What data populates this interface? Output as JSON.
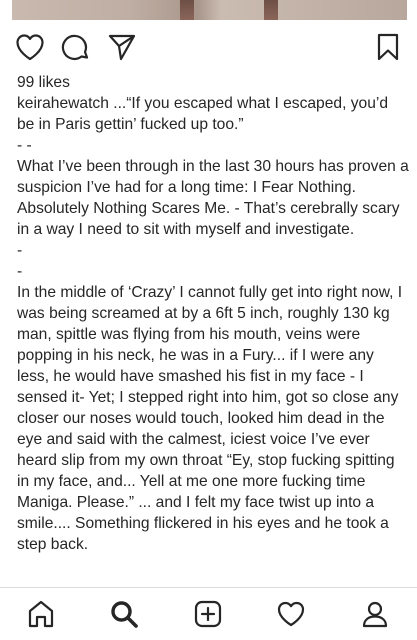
{
  "post": {
    "likes": "99 likes",
    "username": "keirahewatch",
    "caption": [
      "...“If you escaped what I escaped, you’d be in Paris gettin’ fucked up too.”",
      "- -",
      "What I’ve been through in the last 30 hours has proven a suspicion I’ve had for a long time: I Fear Nothing. Absolutely Nothing Scares Me. - That’s cerebrally scary in a way I need to sit with myself and investigate.",
      "-",
      "-",
      "In the middle of ‘Crazy’ I cannot fully get into right now, I was being screamed at by a 6ft 5 inch, roughly 130 kg man, spittle was flying from his mouth, veins were popping in his neck, he was in a Fury... if I were any less, he would have smashed his fist in my face - I sensed it- Yet; I stepped right into him, got so close any closer our noses would touch, looked him dead in the eye and said with the calmest, iciest voice I’ve ever heard slip from my own throat “Ey, stop fucking spitting in my face, and... Yell at me one more fucking time Maniga. Please.” ... and I felt my face twist up into a smile.... Something flickered in his eyes and he took a step back."
    ]
  },
  "icons": {
    "like": "heart-icon",
    "comment": "comment-bubble-icon",
    "share": "paper-plane-icon",
    "save": "bookmark-icon",
    "home": "home-icon",
    "search": "search-icon",
    "add": "add-post-icon",
    "activity": "heart-icon",
    "profile": "profile-icon"
  },
  "colors": {
    "text": "#262626",
    "icon": "#262626",
    "divider": "#dbdbdb"
  }
}
